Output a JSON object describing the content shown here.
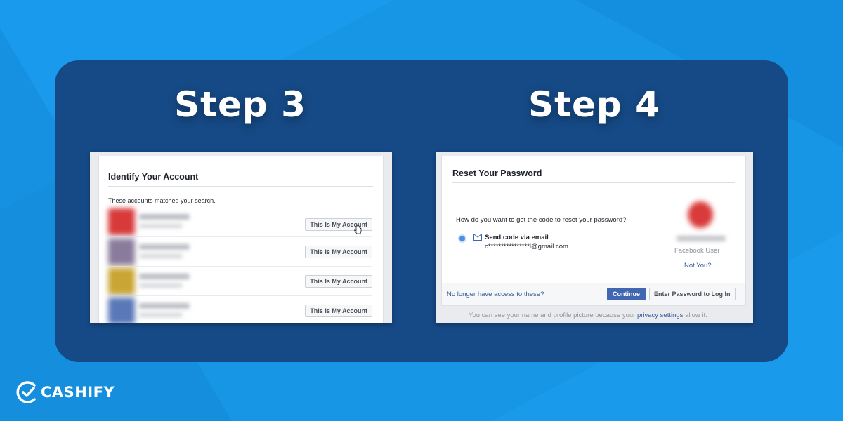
{
  "step3": {
    "title": "Step 3",
    "heading": "Identify Your Account",
    "intro": "These accounts matched your search.",
    "button_label": "This Is My Account",
    "accounts": [
      {
        "button": "This Is My Account"
      },
      {
        "button": "This Is My Account"
      },
      {
        "button": "This Is My Account"
      },
      {
        "button": "This Is My Account"
      }
    ]
  },
  "step4": {
    "title": "Step 4",
    "heading": "Reset Your Password",
    "question": "How do you want to get the code to reset your password?",
    "option_label": "Send code via email",
    "email": "c****************l@gmail.com",
    "profile_caption": "Facebook User",
    "not_you": "Not You?",
    "no_access": "No longer have access to these?",
    "continue_label": "Continue",
    "enter_password_label": "Enter Password to Log In",
    "footer_prefix": "You can see your name and profile picture because your",
    "footer_link": "privacy settings",
    "footer_suffix": "allow it."
  },
  "brand": {
    "name": "CASHIFY"
  },
  "colors": {
    "background": "#1896e6",
    "card": "#164a86",
    "fb_blue": "#4267b2",
    "fb_link": "#365899"
  }
}
